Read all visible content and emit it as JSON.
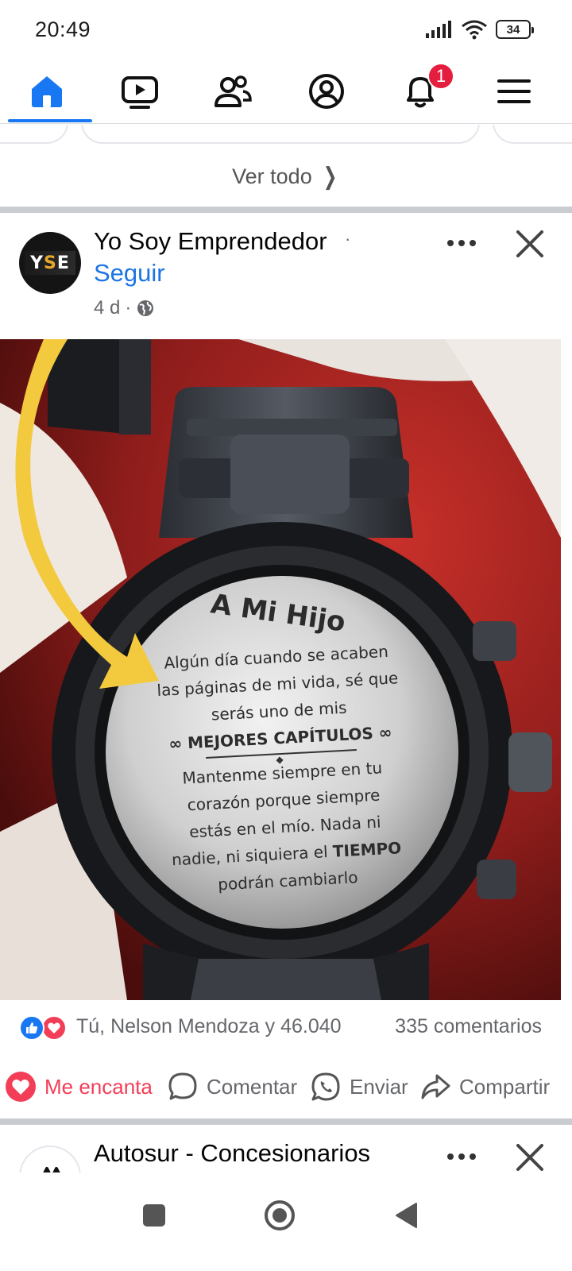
{
  "status_bar": {
    "time": "20:49",
    "battery": "34"
  },
  "nav": {
    "notifications_badge": "1"
  },
  "stories": {
    "see_all": "Ver todo"
  },
  "post": {
    "page_name": "Yo Soy Emprendedor",
    "separator": "·",
    "follow": "Seguir",
    "time": "4 d",
    "meta_dot": "·",
    "avatar_text": "YSE",
    "image_text": {
      "title": "A Mi Hijo",
      "line1": "Algún día cuando se acaben",
      "line2": "las páginas de mi vida, sé que",
      "line3": "serás uno de mis",
      "line4": "∞ MEJORES CAPÍTULOS ∞",
      "line5": "Mantenme siempre en tu",
      "line6": "corazón porque siempre",
      "line7": "estás en el mío. Nada ni",
      "line8a": "nadie, ni siquiera el ",
      "line8b": "TIEMPO",
      "line9": "podrán cambiarlo"
    },
    "reactions_text": "Tú, Nelson Mendoza y 46.040",
    "comments_count": "335 comentarios",
    "actions": {
      "love": "Me encanta",
      "comment": "Comentar",
      "send": "Enviar",
      "share": "Compartir"
    }
  },
  "next_post": {
    "page_name": "Autosur - Concesionarios"
  },
  "colors": {
    "brand_blue": "#1877f2",
    "love_red": "#f33e58",
    "badge_red": "#e41e3f",
    "link_blue": "#1b74e4"
  }
}
